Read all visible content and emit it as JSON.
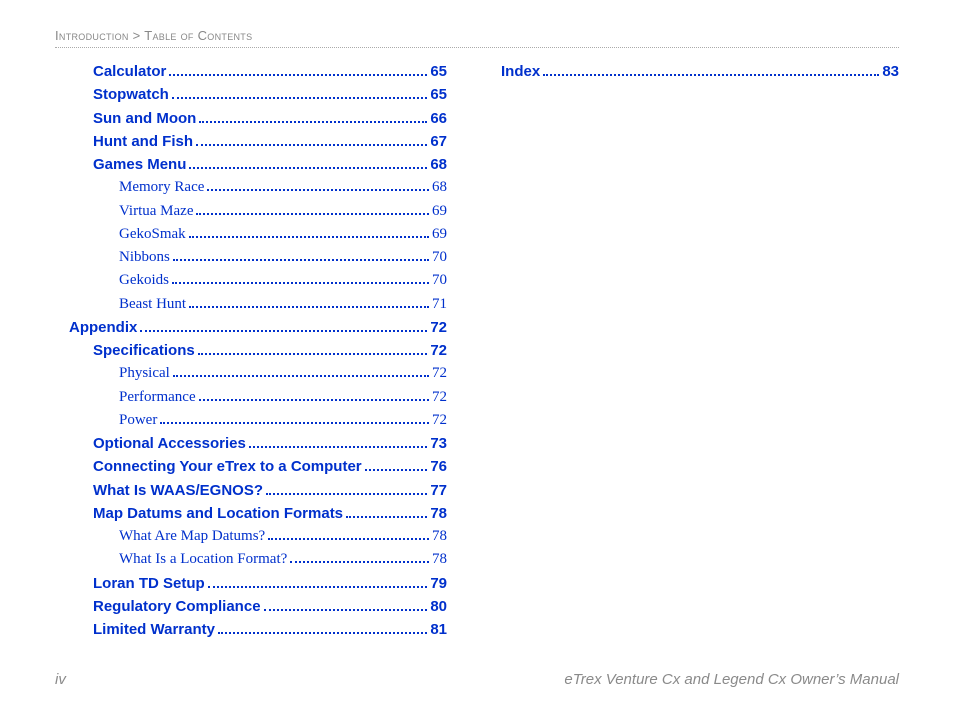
{
  "header": {
    "left": "Introduction",
    "sep": ">",
    "right": "Table of Contents"
  },
  "columns": {
    "left": [
      {
        "label": "Calculator",
        "page": "65",
        "type": "bold",
        "indent": 1
      },
      {
        "label": "Stopwatch",
        "page": "65",
        "type": "bold",
        "indent": 1
      },
      {
        "label": "Sun and Moon",
        "page": "66",
        "type": "bold",
        "indent": 1
      },
      {
        "label": "Hunt and Fish",
        "page": "67",
        "type": "bold",
        "indent": 1
      },
      {
        "label": "Games Menu",
        "page": "68",
        "type": "bold",
        "indent": 1
      },
      {
        "label": "Memory Race",
        "page": "68",
        "type": "serif",
        "indent": 2
      },
      {
        "label": "Virtua Maze",
        "page": "69",
        "type": "serif",
        "indent": 2
      },
      {
        "label": "GekoSmak",
        "page": "69",
        "type": "serif",
        "indent": 2
      },
      {
        "label": "Nibbons",
        "page": "70",
        "type": "serif",
        "indent": 2
      },
      {
        "label": "Gekoids",
        "page": "70",
        "type": "serif",
        "indent": 2
      },
      {
        "label": "Beast Hunt",
        "page": "71",
        "type": "serif",
        "indent": 2
      },
      {
        "label": "Appendix",
        "page": "72",
        "type": "bold",
        "indent": 0
      },
      {
        "label": "Specifications",
        "page": "72",
        "type": "bold",
        "indent": 1
      },
      {
        "label": "Physical",
        "page": "72",
        "type": "serif",
        "indent": 2
      },
      {
        "label": "Performance",
        "page": "72",
        "type": "serif",
        "indent": 2
      },
      {
        "label": "Power",
        "page": "72",
        "type": "serif",
        "indent": 2
      },
      {
        "label": "Optional Accessories",
        "page": "73",
        "type": "bold",
        "indent": 1
      },
      {
        "label": "Connecting Your eTrex to a Computer",
        "page": "76",
        "type": "bold",
        "indent": 1
      },
      {
        "label": "What Is WAAS/EGNOS?",
        "page": "77",
        "type": "bold",
        "indent": 1
      },
      {
        "label": "Map Datums and Location Formats",
        "page": "78",
        "type": "bold",
        "indent": 1
      },
      {
        "label": "What Are Map Datums?",
        "page": "78",
        "type": "serif",
        "indent": 2
      },
      {
        "label": "What Is a Location Format?",
        "page": "78",
        "type": "serif",
        "indent": 2
      },
      {
        "label": "Loran TD Setup",
        "page": "79",
        "type": "bold",
        "indent": 1
      },
      {
        "label": "Regulatory Compliance",
        "page": "80",
        "type": "bold",
        "indent": 1
      },
      {
        "label": "Limited Warranty",
        "page": "81",
        "type": "bold",
        "indent": 1
      }
    ],
    "right": [
      {
        "label": "Index",
        "page": "83",
        "type": "bold",
        "indent": 0
      }
    ]
  },
  "footer": {
    "page_no": "iv",
    "title": "eTrex Venture Cx and Legend Cx Owner’s Manual"
  }
}
